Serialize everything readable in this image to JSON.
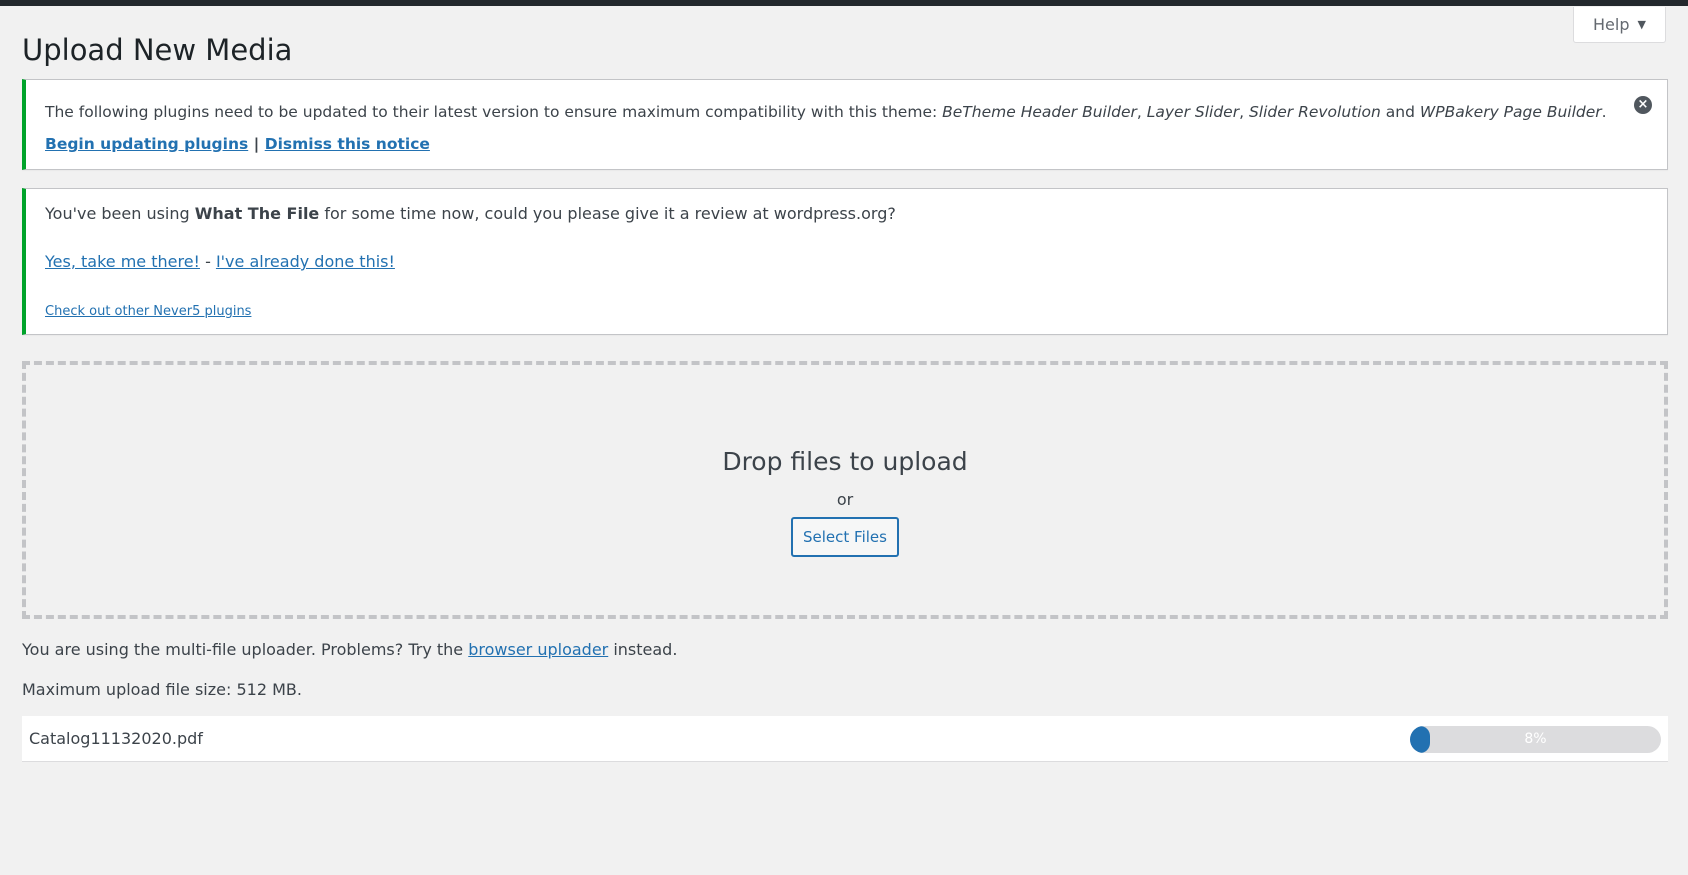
{
  "page": {
    "title": "Upload New Media"
  },
  "help_tab": {
    "label": "Help",
    "caret": "▼"
  },
  "notice_plugins": {
    "text_prefix": "The following plugins need to be updated to their latest version to ensure maximum compatibility with this theme: ",
    "plugins": [
      "BeTheme Header Builder",
      "Layer Slider",
      "Slider Revolution",
      "WPBakery Page Builder"
    ],
    "comma": ", ",
    "and": " and ",
    "period": ".",
    "begin_link": "Begin updating plugins",
    "separator": "|",
    "dismiss_link": "Dismiss this notice",
    "close_icon": "×"
  },
  "notice_review": {
    "text_before": "You've been using ",
    "plugin_name": "What The File",
    "text_after": " for some time now, could you please give it a review at wordpress.org?",
    "yes_link": "Yes, take me there!",
    "dash": "-",
    "done_link": "I've already done this!",
    "other_link": "Check out other Never5 plugins"
  },
  "upload": {
    "drop_title": "Drop files to upload",
    "or": "or",
    "select_button": "Select Files"
  },
  "info": {
    "uploader_before": "You are using the multi-file uploader. Problems? Try the ",
    "uploader_link": "browser uploader",
    "uploader_after": " instead.",
    "max_size": "Maximum upload file size: 512 MB."
  },
  "file_item": {
    "name": "Catalog11132020.pdf",
    "progress_percent": 8,
    "progress_label": "8%"
  },
  "colors": {
    "accent": "#2271b1",
    "notice_border": "#00a32a",
    "topbar": "#23282d"
  }
}
